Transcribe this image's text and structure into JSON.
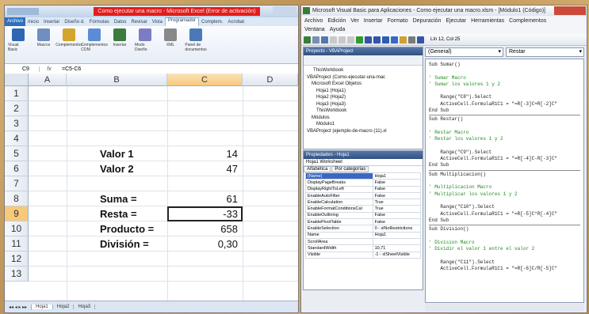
{
  "excel": {
    "title": "Como ejecutar una macro - Microsoft Excel (Error de activación)",
    "tabs": [
      "Archivo",
      "Inicio",
      "Insertar",
      "Diseño d.",
      "Fórmulas",
      "Datos",
      "Revisar",
      "Vista",
      "Programador",
      "Complem.",
      "Acrobat"
    ],
    "active_tab": "Programador",
    "ribbon": [
      "Visual Basic",
      "Macros",
      "Complementos",
      "Complementos COM",
      "Insertar",
      "Modo Diseño",
      "XML",
      "Panel de documentos"
    ],
    "ribbon_groups": [
      "Código",
      "Complementos",
      "Controles",
      "Modificar"
    ],
    "name_box": "C9",
    "formula": "=C5-C6",
    "columns": [
      "A",
      "B",
      "C",
      "D"
    ],
    "rows": [
      "1",
      "2",
      "3",
      "4",
      "5",
      "6",
      "7",
      "8",
      "9",
      "10",
      "11",
      "12",
      "13"
    ],
    "cells": {
      "B5": "Valor 1",
      "C5": "14",
      "B6": "Valor 2",
      "C6": "47",
      "B8": "Suma =",
      "C8": "61",
      "B9": "Resta =",
      "C9": "-33",
      "B10": "Producto =",
      "C10": "658",
      "B11": "División =",
      "C11": "0,30"
    },
    "sheets": [
      "Hoja1",
      "Hoja2",
      "Hoja3"
    ],
    "accent": "#2f6fc0",
    "title_bar_color": "#e21d1d"
  },
  "vba": {
    "title": "Microsoft Visual Basic para Aplicaciones - Como ejecutar una macro.xlsm - [Módulo1 (Código)]",
    "menu": [
      "Archivo",
      "Edición",
      "Ver",
      "Insertar",
      "Formato",
      "Depuración",
      "Ejecutar",
      "Herramientas",
      "Complementos"
    ],
    "menu2": [
      "Ventana",
      "Ayuda"
    ],
    "position": "Lín 12, Col 25",
    "project_title": "Proyecto - VBAProject",
    "tree": [
      "ThisWorkbook",
      "VBAProject (Como-ejecutar-una-mac",
      "Microsoft Excel Objetos",
      "Hoja1 (Hoja1)",
      "Hoja2 (Hoja2)",
      "Hoja3 (Hoja3)",
      "ThisWorkbook",
      "Módulos",
      "Módulo1",
      "VBAProject (ejemplo-de-macro (11).xl"
    ],
    "props_title": "Propiedades - Hoja1",
    "props_object": "Hoja1 Worksheet",
    "props_tabs": [
      "Alfabética",
      "Por categorías"
    ],
    "props": [
      [
        "(Name)",
        "Hoja1"
      ],
      [
        "DisplayPageBreaks",
        "False"
      ],
      [
        "DisplayRightToLeft",
        "False"
      ],
      [
        "EnableAutoFilter",
        "False"
      ],
      [
        "EnableCalculation",
        "True"
      ],
      [
        "EnableFormatConditionsCal",
        "True"
      ],
      [
        "EnableOutlining",
        "False"
      ],
      [
        "EnablePivotTable",
        "False"
      ],
      [
        "EnableSelection",
        "0 - xlNoRestrictions"
      ],
      [
        "Name",
        "Hoja1"
      ],
      [
        "ScrollArea",
        ""
      ],
      [
        "StandardWidth",
        "10,71"
      ],
      [
        "Visible",
        "-1 - xlSheetVisible"
      ]
    ],
    "combo_left": "(General)",
    "combo_right": "Restar",
    "code": [
      {
        "t": "Sub Sumar()",
        "c": false
      },
      {
        "t": "",
        "c": false
      },
      {
        "t": "' Sumar Macro",
        "c": true
      },
      {
        "t": "' Sumar los valores 1 y 2",
        "c": true
      },
      {
        "t": "",
        "c": false
      },
      {
        "t": "    Range(\"C8\").Select",
        "c": false
      },
      {
        "t": "    ActiveCell.FormulaR1C1 = \"=R[-3]C+R[-2]C\"",
        "c": false
      },
      {
        "t": "End Sub",
        "c": false,
        "sep": true
      },
      {
        "t": "Sub Restar()",
        "c": false
      },
      {
        "t": "",
        "c": false
      },
      {
        "t": "' Restar Macro",
        "c": true
      },
      {
        "t": "' Restar los valores 1 y 2",
        "c": true
      },
      {
        "t": "",
        "c": false
      },
      {
        "t": "    Range(\"C9\").Select",
        "c": false
      },
      {
        "t": "    ActiveCell.FormulaR1C1 = \"=R[-4]C-R[-3]C\"",
        "c": false
      },
      {
        "t": "End Sub",
        "c": false,
        "sep": true
      },
      {
        "t": "Sub Multiplicacion()",
        "c": false
      },
      {
        "t": "",
        "c": false
      },
      {
        "t": "' Multiplicacion Macro",
        "c": true
      },
      {
        "t": "' Multiplicar los valores 1 y 2",
        "c": true
      },
      {
        "t": "",
        "c": false
      },
      {
        "t": "    Range(\"C10\").Select",
        "c": false
      },
      {
        "t": "    ActiveCell.FormulaR1C1 = \"=R[-5]C*R[-4]C\"",
        "c": false
      },
      {
        "t": "End Sub",
        "c": false,
        "sep": true
      },
      {
        "t": "Sub Division()",
        "c": false
      },
      {
        "t": "",
        "c": false
      },
      {
        "t": "' Division Macro",
        "c": true
      },
      {
        "t": "' Dividir el valor 1 entre el valor 2",
        "c": true
      },
      {
        "t": "",
        "c": false
      },
      {
        "t": "    Range(\"C11\").Select",
        "c": false
      },
      {
        "t": "    ActiveCell.FormulaR1C1 = \"=R[-6]C/R[-5]C\"",
        "c": false
      }
    ]
  }
}
